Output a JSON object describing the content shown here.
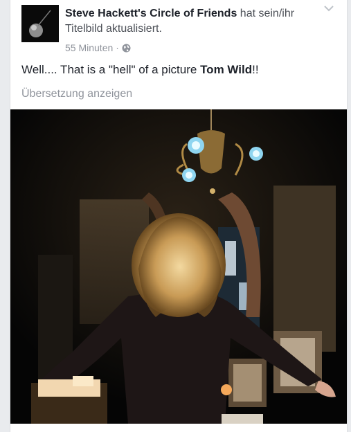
{
  "post": {
    "page_name": "Steve Hackett's Circle of Friends",
    "action_text": " hat sein/ihr Titelbild aktualisiert.",
    "time": "55 Minuten",
    "separator": "·",
    "privacy_icon": "globe-icon",
    "text_prefix": "Well.... That is a \"hell\" of a picture ",
    "tagged_name": "Tom Wild",
    "text_suffix": "!!",
    "translate_link": "Übersetzung anzeigen"
  },
  "icons": {
    "options": "chevron-down-icon"
  },
  "colors": {
    "name": "#1d2129",
    "meta": "#90949c",
    "background": "#e9ebee"
  }
}
